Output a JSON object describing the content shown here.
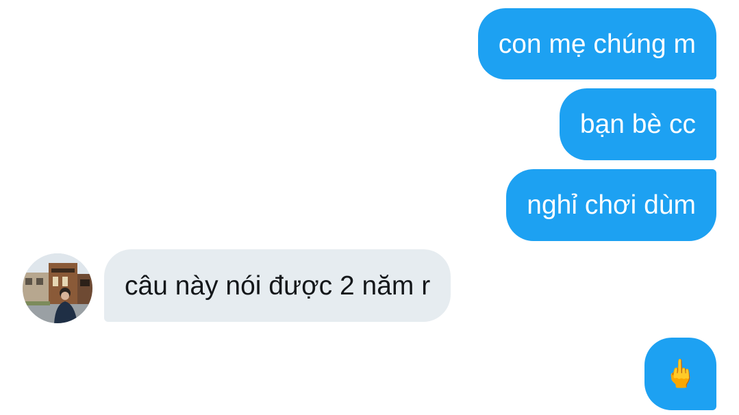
{
  "conversation": {
    "outgoing_color": "#1da1f2",
    "incoming_color": "#e6ecf0",
    "messages": [
      {
        "direction": "outgoing",
        "text": "con mẹ chúng m"
      },
      {
        "direction": "outgoing",
        "text": "bạn bè cc"
      },
      {
        "direction": "outgoing",
        "text": "nghỉ chơi dùm"
      },
      {
        "direction": "incoming",
        "text": "câu này nói được 2 năm r"
      },
      {
        "direction": "outgoing",
        "text": "🖕"
      }
    ]
  },
  "contact": {
    "avatar_icon": "profile-photo-avatar"
  }
}
